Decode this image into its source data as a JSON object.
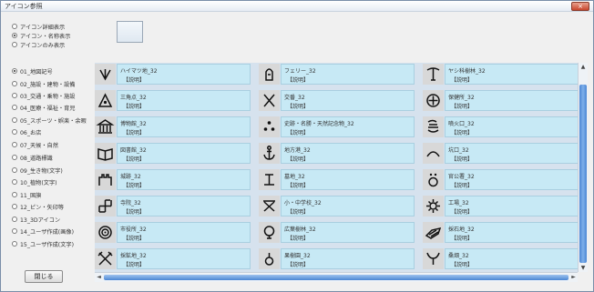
{
  "window": {
    "title": "アイコン参照",
    "close_label": "×"
  },
  "display_modes": [
    {
      "label": "アイコン詳細表示",
      "selected": false
    },
    {
      "label": "アイコン・名称表示",
      "selected": true
    },
    {
      "label": "アイコンのみ表示",
      "selected": false
    }
  ],
  "categories": [
    {
      "label": "01_地図記号",
      "selected": true
    },
    {
      "label": "02_施設・建物・設備",
      "selected": false
    },
    {
      "label": "03_交通・乗物・施設",
      "selected": false
    },
    {
      "label": "04_医療・福祉・育児",
      "selected": false
    },
    {
      "label": "05_スポーツ・娯楽・余暇",
      "selected": false
    },
    {
      "label": "06_お店",
      "selected": false
    },
    {
      "label": "07_天候・自然",
      "selected": false
    },
    {
      "label": "08_道路標識",
      "selected": false
    },
    {
      "label": "09_生き物(文字)",
      "selected": false
    },
    {
      "label": "10_植物(文字)",
      "selected": false
    },
    {
      "label": "11_国旗",
      "selected": false
    },
    {
      "label": "12_ピン・矢印等",
      "selected": false
    },
    {
      "label": "13_3Dアイコン",
      "selected": false
    },
    {
      "label": "14_ユーザ作成(画像)",
      "selected": false
    },
    {
      "label": "15_ユーザ作成(文字)",
      "selected": false
    }
  ],
  "close_button": "閉じる",
  "icons": [
    {
      "name": "ハイマツ地_32",
      "desc": "【説明】",
      "icon": "haimatsu-icon"
    },
    {
      "name": "フェリー_32",
      "desc": "【説明】",
      "icon": "ferry-icon"
    },
    {
      "name": "ヤシ科樹林_32",
      "desc": "【説明】",
      "icon": "palm-forest-icon"
    },
    {
      "name": "三角点_32",
      "desc": "【説明】",
      "icon": "triangulation-point-icon"
    },
    {
      "name": "交番_32",
      "desc": "【説明】",
      "icon": "police-box-icon"
    },
    {
      "name": "保健所_32",
      "desc": "【説明】",
      "icon": "health-center-icon"
    },
    {
      "name": "博物館_32",
      "desc": "【説明】",
      "icon": "museum-icon"
    },
    {
      "name": "史跡・名勝・天然記念物_32",
      "desc": "【説明】",
      "icon": "historic-site-icon"
    },
    {
      "name": "噴火口_32",
      "desc": "【説明】",
      "icon": "crater-icon"
    },
    {
      "name": "図書館_32",
      "desc": "【説明】",
      "icon": "library-icon"
    },
    {
      "name": "地方港_32",
      "desc": "【説明】",
      "icon": "local-port-icon"
    },
    {
      "name": "坑口_32",
      "desc": "【説明】",
      "icon": "mine-entrance-icon"
    },
    {
      "name": "城跡_32",
      "desc": "【説明】",
      "icon": "castle-ruins-icon"
    },
    {
      "name": "墓地_32",
      "desc": "【説明】",
      "icon": "cemetery-icon"
    },
    {
      "name": "官公署_32",
      "desc": "【説明】",
      "icon": "government-office-icon"
    },
    {
      "name": "寺院_32",
      "desc": "【説明】",
      "icon": "temple-icon"
    },
    {
      "name": "小・中学校_32",
      "desc": "【説明】",
      "icon": "school-icon"
    },
    {
      "name": "工場_32",
      "desc": "【説明】",
      "icon": "factory-icon"
    },
    {
      "name": "市役所_32",
      "desc": "【説明】",
      "icon": "city-hall-icon"
    },
    {
      "name": "広葉樹林_32",
      "desc": "【説明】",
      "icon": "broadleaf-forest-icon"
    },
    {
      "name": "採石地_32",
      "desc": "【説明】",
      "icon": "quarry-icon"
    },
    {
      "name": "採鉱地_32",
      "desc": "【説明】",
      "icon": "mining-site-icon"
    },
    {
      "name": "果樹園_32",
      "desc": "【説明】",
      "icon": "orchard-icon"
    },
    {
      "name": "桑畑_32",
      "desc": "【説明】",
      "icon": "mulberry-field-icon"
    }
  ],
  "scrollbars": {
    "up": "▲",
    "down": "▼",
    "left": "◄",
    "right": "►"
  }
}
